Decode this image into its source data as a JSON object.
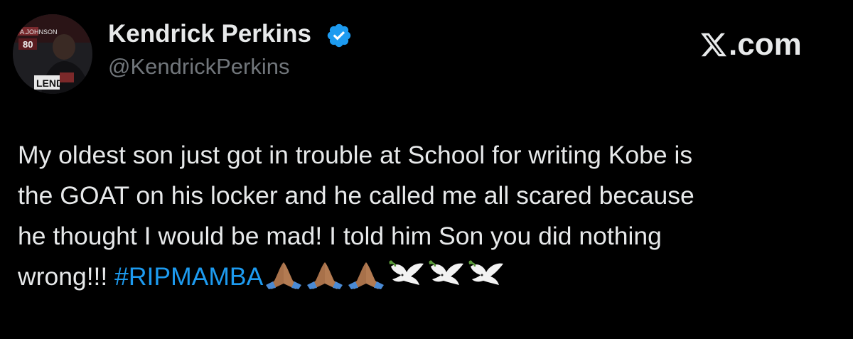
{
  "author": {
    "name": "Kendrick Perkins",
    "handle": "@KendrickPerkins",
    "verified": true,
    "avatar_icon": "profile-photo"
  },
  "site_mark": {
    "letter": "X",
    "suffix": ".com"
  },
  "tweet": {
    "lines": [
      "My oldest son just got in trouble at School for writing Kobe is",
      "the GOAT on his locker and he called me all scared because",
      "he thought I would be mad! I told him Son you did nothing"
    ],
    "last_line_text": "wrong!!! ",
    "hashtag": "#RIPMAMBA",
    "emojis": [
      "folded-hands-medium-dark",
      "folded-hands-medium-dark",
      "folded-hands-medium-dark",
      "dove",
      "dove",
      "dove"
    ]
  },
  "colors": {
    "background": "#000000",
    "text": "#e7e9ea",
    "secondary_text": "#71767b",
    "link": "#1d9bf0",
    "verified": "#1d9bf0"
  }
}
